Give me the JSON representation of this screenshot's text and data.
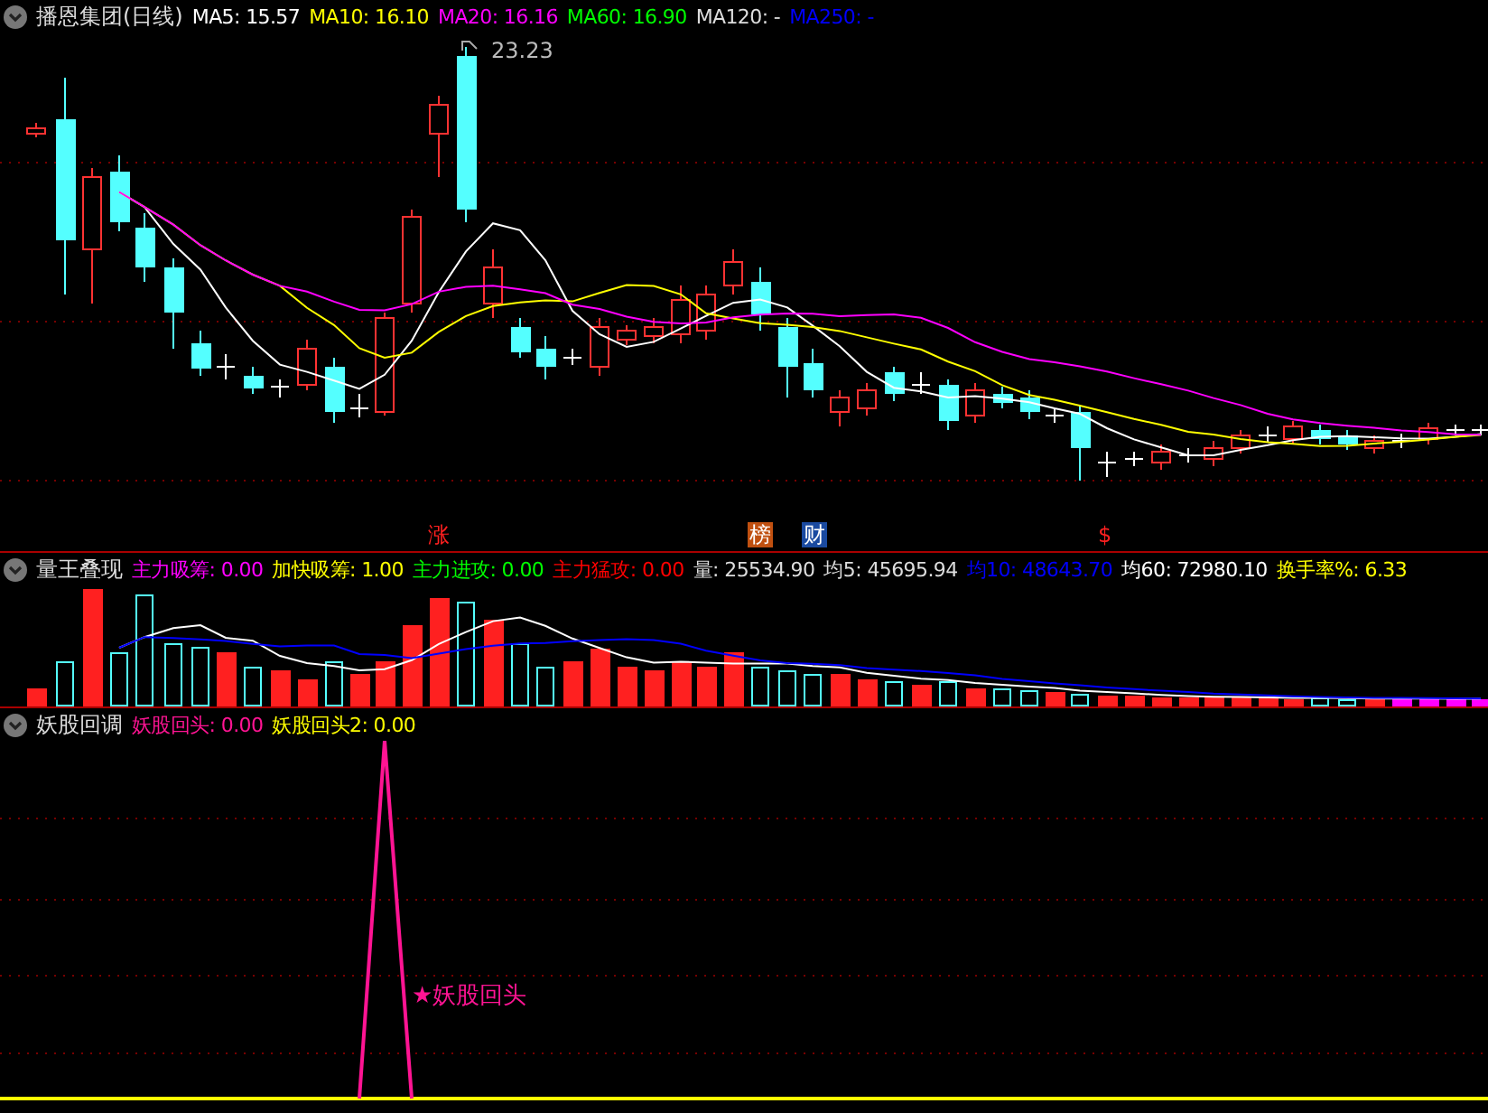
{
  "price_panel": {
    "title": "播恩集团(日线)",
    "legend": [
      {
        "label": "MA5: 15.57",
        "color": "#ffffff"
      },
      {
        "label": "MA10: 16.10",
        "color": "#ffff00"
      },
      {
        "label": "MA20: 16.16",
        "color": "#ff00ff"
      },
      {
        "label": "MA60: 16.90",
        "color": "#00ff00"
      },
      {
        "label": "MA120: -",
        "color": "#dddddd"
      },
      {
        "label": "MA250: -",
        "color": "#0000ff"
      }
    ],
    "high_label": "23.23",
    "markers": [
      {
        "text": "涨",
        "kind": "plain",
        "color": "#ff2020"
      },
      {
        "text": "榜",
        "kind": "tag",
        "color": "#c05010"
      },
      {
        "text": "财",
        "kind": "tag",
        "color": "#1a4aa0"
      },
      {
        "text": "$",
        "kind": "plain",
        "color": "#ff2020"
      }
    ]
  },
  "volume_panel": {
    "title": "量王叠现",
    "legend": [
      {
        "label": "主力吸筹: 0.00",
        "color": "#ff00ff"
      },
      {
        "label": "加快吸筹: 1.00",
        "color": "#ffff00"
      },
      {
        "label": "主力进攻: 0.00",
        "color": "#00ff00"
      },
      {
        "label": "主力猛攻: 0.00",
        "color": "#ff0000"
      },
      {
        "label": "量: 25534.90",
        "color": "#dddddd"
      },
      {
        "label": "均5: 45695.94",
        "color": "#dddddd"
      },
      {
        "label": "均10: 48643.70",
        "color": "#0000ff"
      },
      {
        "label": "均60: 72980.10",
        "color": "#ffffff"
      },
      {
        "label": "换手率%: 6.33",
        "color": "#ffff00"
      }
    ]
  },
  "indicator_panel": {
    "title": "妖股回调",
    "legend": [
      {
        "label": "妖股回头: 0.00",
        "color": "#ff1493"
      },
      {
        "label": "妖股回头2: 0.00",
        "color": "#ffff00"
      }
    ],
    "annotation": "★妖股回头"
  }
}
